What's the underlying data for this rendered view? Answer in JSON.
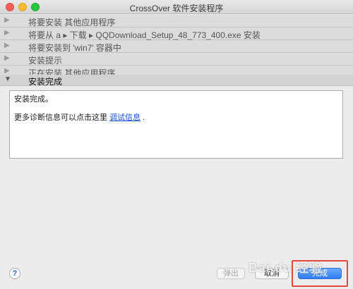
{
  "window": {
    "title": "CrossOver 软件安装程序"
  },
  "steps": [
    {
      "label": "将要安装 其他应用程序",
      "state": "collapsed"
    },
    {
      "label": "将要从 a ▸ 下载 ▸ QQDownload_Setup_48_773_400.exe 安装",
      "state": "collapsed"
    },
    {
      "label": "将要安装到 'win7' 容器中",
      "state": "collapsed"
    },
    {
      "label": "安装提示",
      "state": "collapsed"
    },
    {
      "label": "正在安装 其他应用程序...",
      "state": "collapsed"
    },
    {
      "label": "安装完成",
      "state": "expanded"
    }
  ],
  "log": {
    "line1": "安装完成。",
    "line2_prefix": "更多诊断信息可以点击这里",
    "line2_link": "调试信息",
    "line2_suffix": "."
  },
  "footer": {
    "help": "?",
    "eject": "弹出",
    "cancel": "取消",
    "done": "完成"
  },
  "watermark": "Bai du 经验",
  "colors": {
    "done_button": "#2f7cf5",
    "highlight": "#e2473a"
  }
}
